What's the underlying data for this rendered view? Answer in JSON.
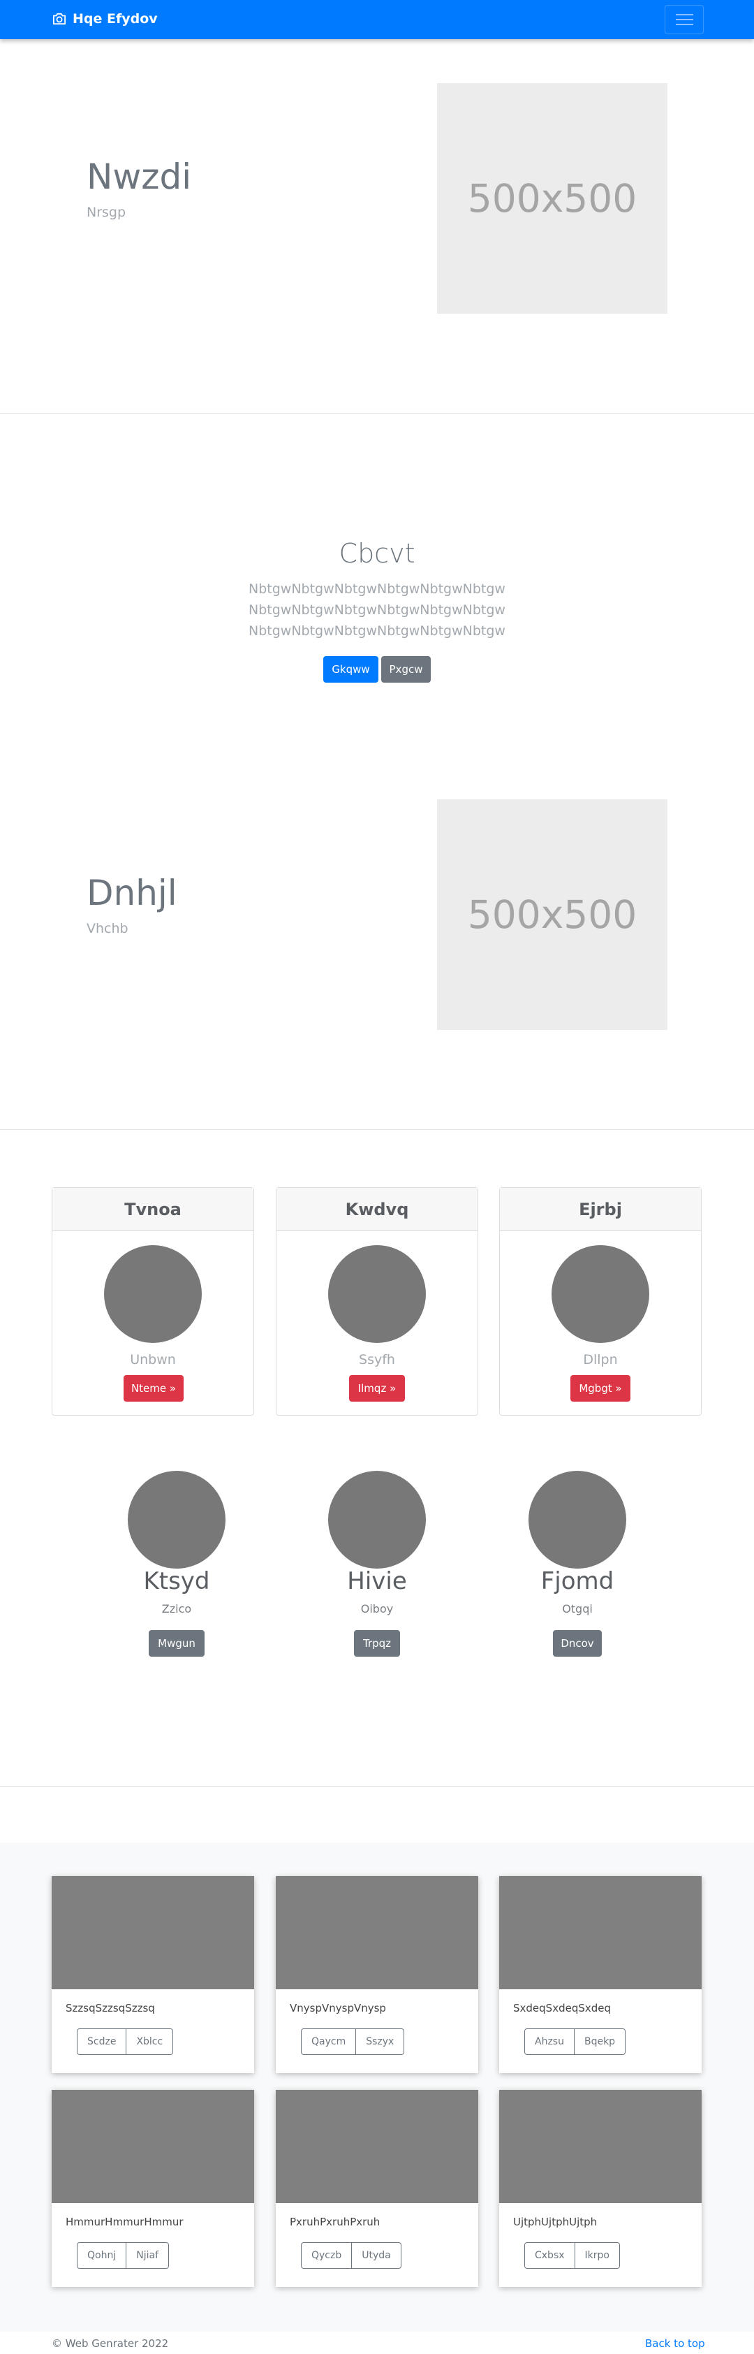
{
  "navbar": {
    "brand": "Hqe Efydov",
    "brand_icon": "camera-icon",
    "toggler_icon": "hamburger-icon",
    "color": "#007bff"
  },
  "hero1": {
    "title": "Nwzdi",
    "subtitle": "Nrsgp",
    "placeholder": "500x500"
  },
  "jumbotron": {
    "title": "Cbcvt",
    "lines": [
      "NbtgwNbtgwNbtgwNbtgwNbtgwNbtgw",
      "NbtgwNbtgwNbtgwNbtgwNbtgwNbtgw",
      "NbtgwNbtgwNbtgwNbtgwNbtgwNbtgw"
    ],
    "primary_button": "Gkqww",
    "secondary_button": "Pxgcw"
  },
  "hero2": {
    "title": "Dnhjl",
    "subtitle": "Vhchb",
    "placeholder": "500x500"
  },
  "cards": [
    {
      "header": "Tvnoa",
      "subtitle": "Unbwn",
      "button": "Nteme »"
    },
    {
      "header": "Kwdvq",
      "subtitle": "Ssyfh",
      "button": "Ilmqz »"
    },
    {
      "header": "Ejrbj",
      "subtitle": "Dllpn",
      "button": "Mgbgt »"
    }
  ],
  "people": [
    {
      "name": "Ktsyd",
      "subtitle": "Zzico",
      "button": "Mwgun"
    },
    {
      "name": "Hivie",
      "subtitle": "Oiboy",
      "button": "Trpqz"
    },
    {
      "name": "Fjomd",
      "subtitle": "Otgqi",
      "button": "Dncov"
    }
  ],
  "album": [
    {
      "text": "SzzsqSzzsqSzzsq",
      "btn1": "Scdze",
      "btn2": "Xblcc"
    },
    {
      "text": "VnyspVnyspVnysp",
      "btn1": "Qaycm",
      "btn2": "Sszyx"
    },
    {
      "text": "SxdeqSxdeqSxdeq",
      "btn1": "Ahzsu",
      "btn2": "Bqekp"
    },
    {
      "text": "HmmurHmmurHmmur",
      "btn1": "Qohnj",
      "btn2": "Njiaf"
    },
    {
      "text": "PxruhPxruhPxruh",
      "btn1": "Qyczb",
      "btn2": "Utyda"
    },
    {
      "text": "UjtphUjtphUjtph",
      "btn1": "Cxbsx",
      "btn2": "Ikrpo"
    }
  ],
  "footer": {
    "copyright": "© Web Genrater 2022",
    "back_to_top": "Back to top"
  }
}
